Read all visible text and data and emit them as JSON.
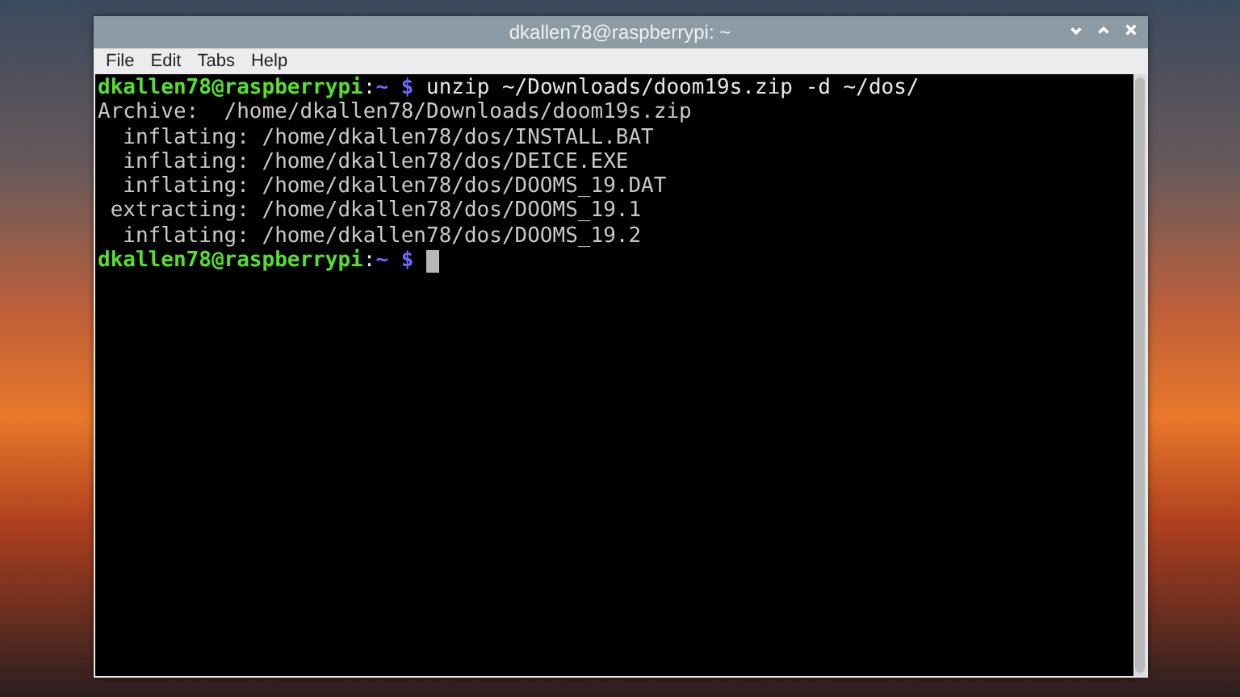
{
  "window": {
    "title": "dkallen78@raspberrypi: ~"
  },
  "menu": [
    "File",
    "Edit",
    "Tabs",
    "Help"
  ],
  "terminal": {
    "lines": [
      {
        "kind": "prompt",
        "user": "dkallen78@raspberrypi",
        "separator": ":",
        "path": "~",
        "symbol": "$",
        "command": "unzip ~/Downloads/doom19s.zip -d ~/dos/",
        "cursor": false
      },
      {
        "kind": "output",
        "text": "Archive:  /home/dkallen78/Downloads/doom19s.zip"
      },
      {
        "kind": "output",
        "text": "  inflating: /home/dkallen78/dos/INSTALL.BAT"
      },
      {
        "kind": "output",
        "text": "  inflating: /home/dkallen78/dos/DEICE.EXE"
      },
      {
        "kind": "output",
        "text": "  inflating: /home/dkallen78/dos/DOOMS_19.DAT"
      },
      {
        "kind": "output",
        "text": " extracting: /home/dkallen78/dos/DOOMS_19.1"
      },
      {
        "kind": "output",
        "text": "  inflating: /home/dkallen78/dos/DOOMS_19.2"
      },
      {
        "kind": "prompt",
        "user": "dkallen78@raspberrypi",
        "separator": ":",
        "path": "~",
        "symbol": "$",
        "cursor": true
      }
    ]
  }
}
